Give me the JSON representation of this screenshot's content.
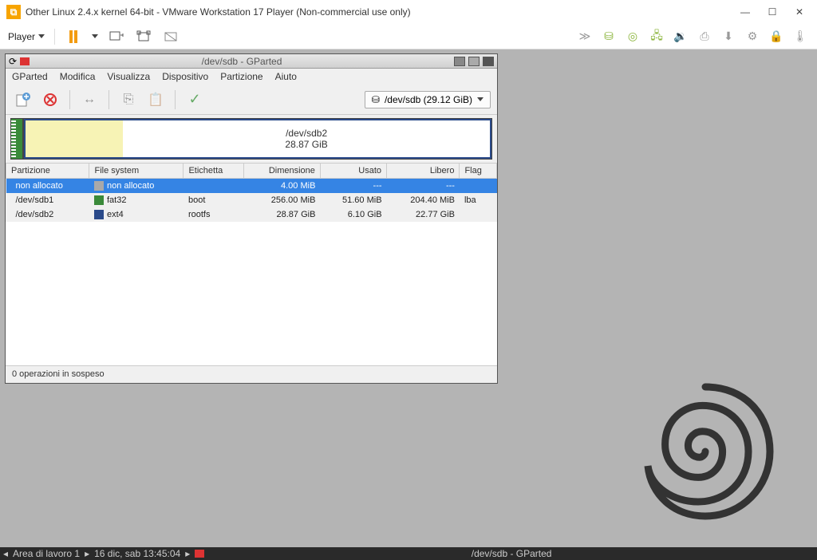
{
  "vm": {
    "title": "Other Linux 2.4.x kernel 64-bit - VMware Workstation 17 Player (Non-commercial use only)",
    "player_label": "Player"
  },
  "gparted": {
    "window_title": "/dev/sdb - GParted",
    "menu": {
      "app": "GParted",
      "edit": "Modifica",
      "view": "Visualizza",
      "device": "Dispositivo",
      "partition": "Partizione",
      "help": "Aiuto"
    },
    "device_selector": "/dev/sdb (29.12 GiB)",
    "map": {
      "label": "/dev/sdb2",
      "size": "28.87 GiB"
    },
    "headers": {
      "partition": "Partizione",
      "filesystem": "File system",
      "label": "Etichetta",
      "size": "Dimensione",
      "used": "Usato",
      "free": "Libero",
      "flag": "Flag"
    },
    "rows": [
      {
        "partition": "non allocato",
        "fs": "non allocato",
        "fscolor": "#a9a9a9",
        "etichetta": "",
        "size": "4.00 MiB",
        "used": "---",
        "free": "---",
        "flag": ""
      },
      {
        "partition": "/dev/sdb1",
        "fs": "fat32",
        "fscolor": "#3a8a3a",
        "etichetta": "boot",
        "size": "256.00 MiB",
        "used": "51.60 MiB",
        "free": "204.40 MiB",
        "flag": "lba"
      },
      {
        "partition": "/dev/sdb2",
        "fs": "ext4",
        "fscolor": "#2a4a8a",
        "etichetta": "rootfs",
        "size": "28.87 GiB",
        "used": "6.10 GiB",
        "free": "22.77 GiB",
        "flag": ""
      }
    ],
    "status": "0 operazioni in sospeso"
  },
  "taskbar": {
    "workspace": "Area di lavoro 1",
    "datetime": "16 dic, sab 13:45:04",
    "active": "/dev/sdb - GParted"
  }
}
